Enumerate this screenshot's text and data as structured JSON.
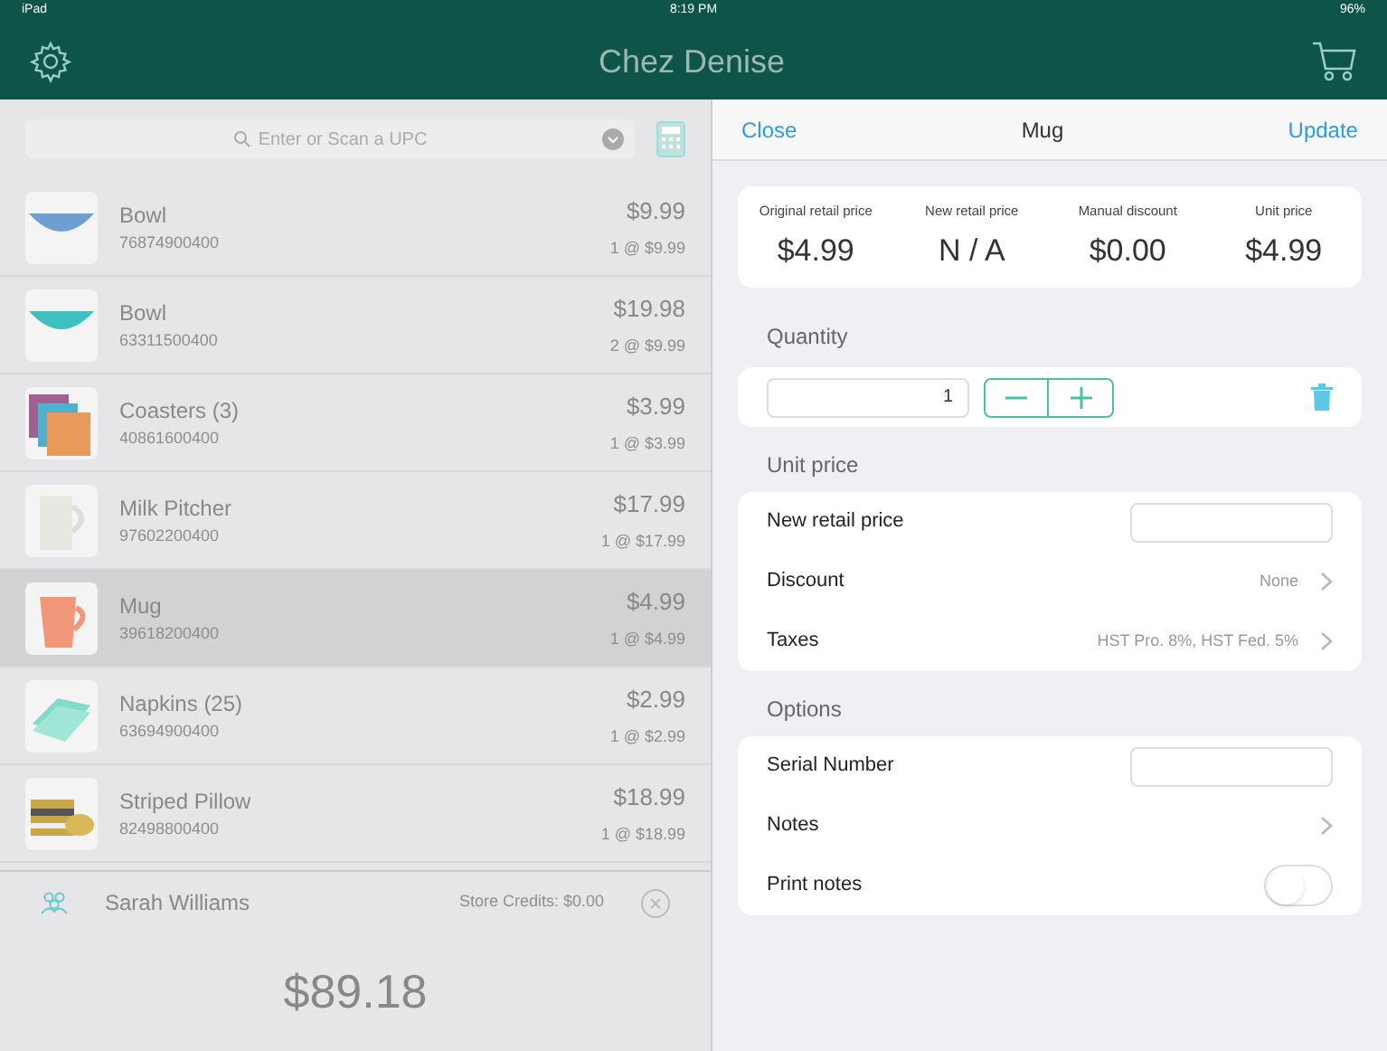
{
  "status_bar": {
    "device": "iPad",
    "time": "8:19 PM",
    "battery": "96%"
  },
  "header": {
    "title": "Chez Denise"
  },
  "search": {
    "placeholder": "Enter or Scan a UPC"
  },
  "cart_items": [
    {
      "name": "Bowl",
      "upc": "76874900400",
      "price": "$9.99",
      "quantity": "1 @ $9.99",
      "selected": false
    },
    {
      "name": "Bowl",
      "upc": "63311500400",
      "price": "$19.98",
      "quantity": "2 @ $9.99",
      "selected": false
    },
    {
      "name": "Coasters (3)",
      "upc": "40861600400",
      "price": "$3.99",
      "quantity": "1 @ $3.99",
      "selected": false
    },
    {
      "name": "Milk Pitcher",
      "upc": "97602200400",
      "price": "$17.99",
      "quantity": "1 @ $17.99",
      "selected": false
    },
    {
      "name": "Mug",
      "upc": "39618200400",
      "price": "$4.99",
      "quantity": "1 @ $4.99",
      "selected": true
    },
    {
      "name": "Napkins (25)",
      "upc": "63694900400",
      "price": "$2.99",
      "quantity": "1 @ $2.99",
      "selected": false
    },
    {
      "name": "Striped Pillow",
      "upc": "82498800400",
      "price": "$18.99",
      "quantity": "1 @ $18.99",
      "selected": false
    }
  ],
  "customer": {
    "name": "Sarah Williams",
    "store_credits": "Store Credits: $0.00"
  },
  "total": "$89.18",
  "detail": {
    "close": "Close",
    "title": "Mug",
    "update": "Update",
    "summary": [
      {
        "label": "Original retail price",
        "value": "$4.99"
      },
      {
        "label": "New retail price",
        "value": "N / A"
      },
      {
        "label": "Manual discount",
        "value": "$0.00"
      },
      {
        "label": "Unit price",
        "value": "$4.99"
      }
    ],
    "quantity_section": "Quantity",
    "quantity": "1",
    "unit_price_section": "Unit price",
    "unit_price_rows": [
      {
        "kind": "field",
        "label": "New retail price"
      },
      {
        "kind": "link",
        "label": "Discount",
        "value": "None"
      },
      {
        "kind": "link",
        "label": "Taxes",
        "value": "HST Pro. 8%, HST Fed. 5%"
      }
    ],
    "options_section": "Options",
    "options_rows": [
      {
        "kind": "field",
        "label": "Serial Number"
      },
      {
        "kind": "link",
        "label": "Notes"
      },
      {
        "kind": "toggle",
        "label": "Print notes",
        "on": false
      }
    ]
  }
}
